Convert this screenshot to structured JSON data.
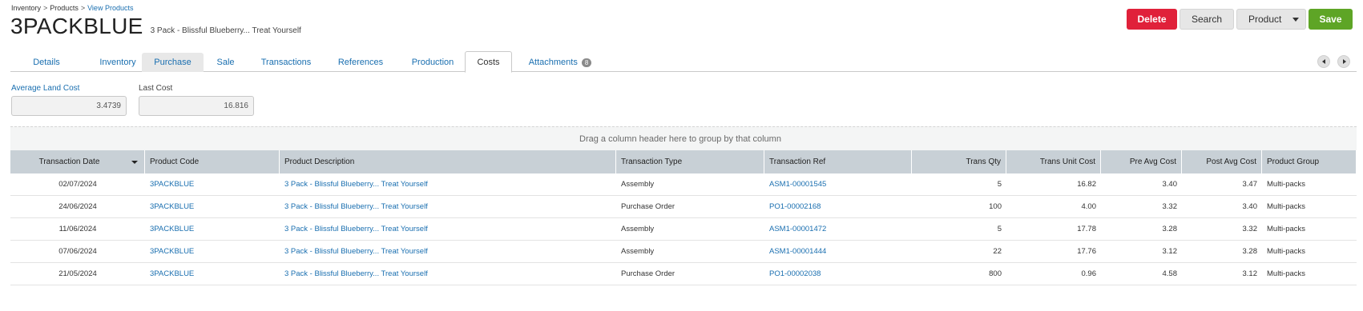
{
  "breadcrumb": {
    "items": [
      "Inventory",
      "Products"
    ],
    "current": "View Products",
    "separator": ">"
  },
  "product": {
    "code": "3PACKBLUE",
    "name": "3 Pack - Blissful Blueberry... Treat Yourself"
  },
  "actions": {
    "delete": "Delete",
    "search": "Search",
    "product": "Product",
    "save": "Save"
  },
  "tabs": [
    {
      "label": "Details"
    },
    {
      "label": "Inventory"
    },
    {
      "label": "Purchase"
    },
    {
      "label": "Sale"
    },
    {
      "label": "Transactions"
    },
    {
      "label": "References"
    },
    {
      "label": "Production"
    },
    {
      "label": "Costs"
    },
    {
      "label": "Attachments",
      "badge": "8"
    }
  ],
  "active_tab": "Costs",
  "costs": {
    "average_land_cost": {
      "label": "Average Land Cost",
      "value": "3.4739"
    },
    "last_cost": {
      "label": "Last Cost",
      "value": "16.816"
    }
  },
  "grid": {
    "group_hint": "Drag a column header here to group by that column",
    "columns": [
      "Transaction Date",
      "Product Code",
      "Product Description",
      "Transaction Type",
      "Transaction Ref",
      "Trans Qty",
      "Trans Unit Cost",
      "Pre Avg Cost",
      "Post Avg Cost",
      "Product Group"
    ],
    "rows": [
      [
        "02/07/2024",
        "3PACKBLUE",
        "3 Pack - Blissful Blueberry... Treat Yourself",
        "Assembly",
        "ASM1-00001545",
        "5",
        "16.82",
        "3.40",
        "3.47",
        "Multi-packs"
      ],
      [
        "24/06/2024",
        "3PACKBLUE",
        "3 Pack - Blissful Blueberry... Treat Yourself",
        "Purchase Order",
        "PO1-00002168",
        "100",
        "4.00",
        "3.32",
        "3.40",
        "Multi-packs"
      ],
      [
        "11/06/2024",
        "3PACKBLUE",
        "3 Pack - Blissful Blueberry... Treat Yourself",
        "Assembly",
        "ASM1-00001472",
        "5",
        "17.78",
        "3.28",
        "3.32",
        "Multi-packs"
      ],
      [
        "07/06/2024",
        "3PACKBLUE",
        "3 Pack - Blissful Blueberry... Treat Yourself",
        "Assembly",
        "ASM1-00001444",
        "22",
        "17.76",
        "3.12",
        "3.28",
        "Multi-packs"
      ],
      [
        "21/05/2024",
        "3PACKBLUE",
        "3 Pack - Blissful Blueberry... Treat Yourself",
        "Purchase Order",
        "PO1-00002038",
        "800",
        "0.96",
        "4.58",
        "3.12",
        "Multi-packs"
      ]
    ]
  },
  "colors": {
    "link": "#1a6fb0",
    "delete": "#e0213a",
    "save": "#5ea526",
    "header_bg": "#c8d0d6"
  },
  "icons": {
    "sort": "sort-desc-icon",
    "tab_prev": "chevron-left-icon",
    "tab_next": "chevron-right-icon",
    "product_menu": "caret-down-icon"
  }
}
